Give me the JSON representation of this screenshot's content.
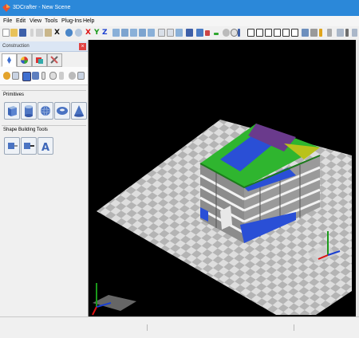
{
  "window": {
    "title": "3DCrafter - New Scene"
  },
  "menu": [
    "File",
    "Edit",
    "View",
    "Tools",
    "Plug-Ins",
    "Help"
  ],
  "toolbar": {
    "axis_x": "X",
    "axis_y": "Y",
    "axis_z": "Z",
    "delete_label": "X"
  },
  "panel": {
    "title": "Construction",
    "close_label": "×",
    "tabs": [
      "object-tab",
      "color-tab",
      "material-tab",
      "tools-tab"
    ],
    "primitives_label": "Primitives",
    "primitives": [
      "cube-icon",
      "cylinder-icon",
      "sphere-icon",
      "torus-icon",
      "cone-icon"
    ],
    "shape_tools_label": "Shape Building Tools",
    "shape_tools": [
      "extrude-icon",
      "lathe-icon",
      "text-3d-icon"
    ],
    "text_tool_glyph": "A"
  },
  "colors": {
    "title_bar": "#2b88d9",
    "viewport": "#000000",
    "building_green": "#2fb52f",
    "building_blue": "#2a4fd6"
  }
}
